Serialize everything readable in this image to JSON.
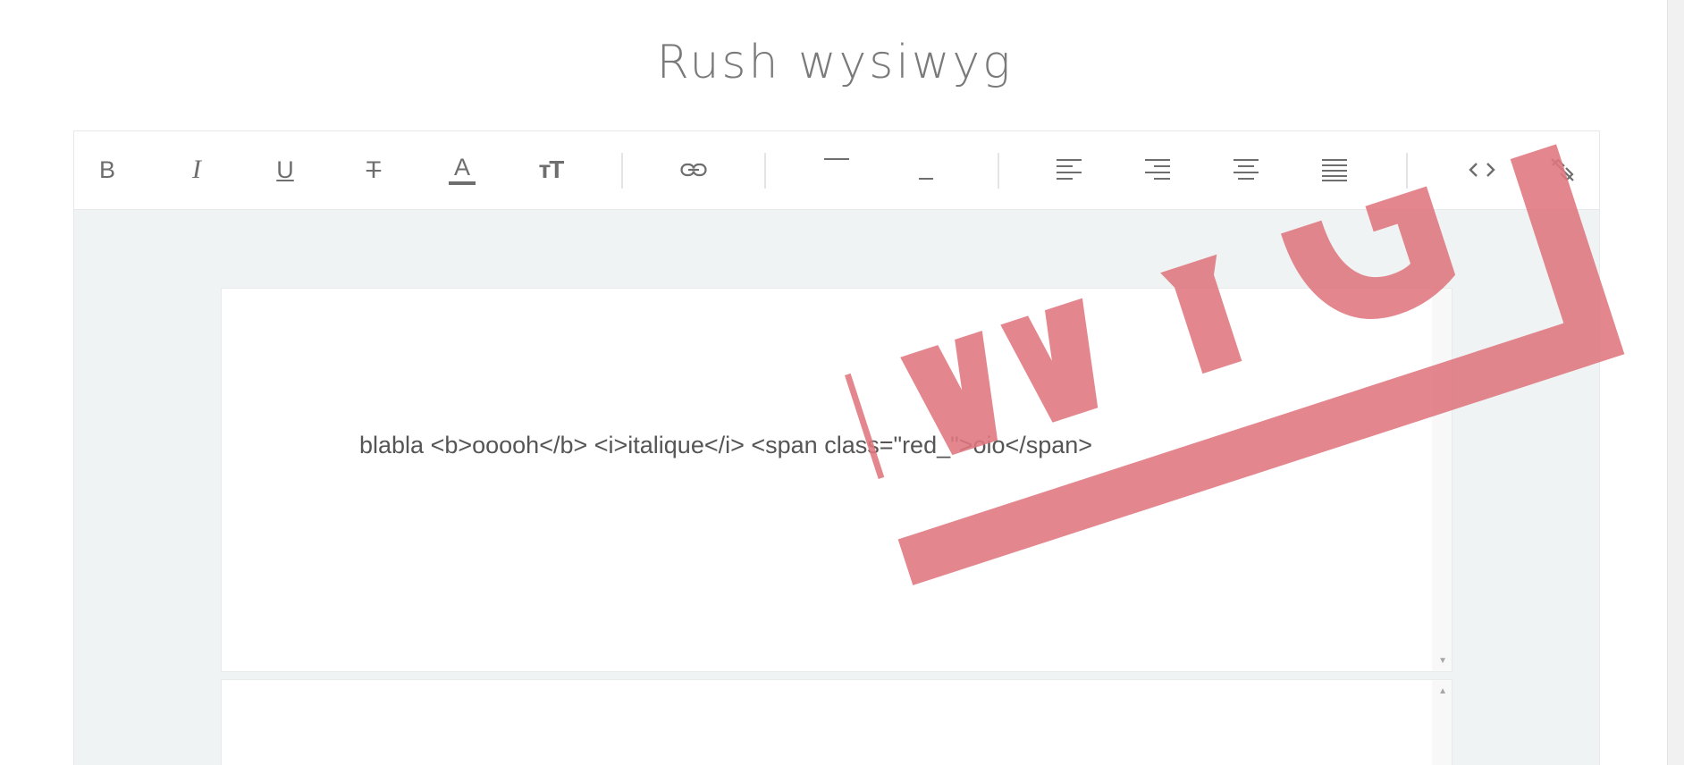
{
  "app": {
    "title": "Rush wysiwyg"
  },
  "toolbar": {
    "bold_label": "B",
    "italic_label": "I",
    "underline_label": "U",
    "strike_label": "T",
    "color_label": "A",
    "fontsize_label": "тT",
    "icons": [
      "bold-icon",
      "italic-icon",
      "underline-icon",
      "strikethrough-icon",
      "font-color-icon",
      "font-size-icon",
      "link-icon",
      "overline-icon",
      "underscore-icon",
      "align-left-icon",
      "align-right-icon",
      "align-center-icon",
      "align-justify-icon",
      "code-view-icon",
      "unlink-icon"
    ]
  },
  "editor": {
    "content": "blabla <b>ooooh</b> <i>italique</i> <span class=\"red_\">oio</span>"
  },
  "stamp": {
    "text": "WYSIWYG",
    "color": "#e0767f"
  },
  "colors": {
    "toolbar_bg": "#ffffff",
    "editor_bg": "#f0f3f3",
    "icon": "#6e6e6e",
    "title": "#7a7a7a"
  }
}
